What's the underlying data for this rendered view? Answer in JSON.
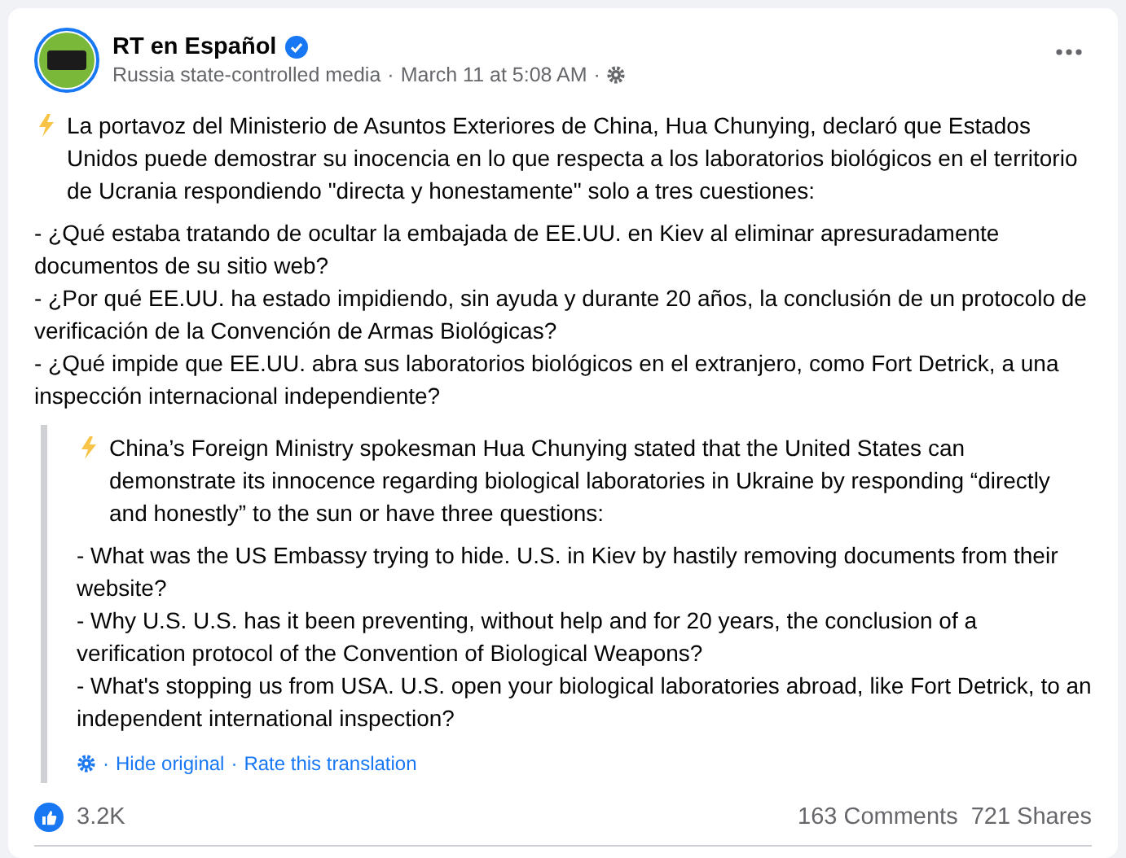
{
  "post": {
    "page_name": "RT en Español",
    "verified": true,
    "subtitle": "Russia state-controlled media",
    "separator": "·",
    "time": "March 11 at 5:08 AM",
    "body": {
      "intro": "La portavoz del Ministerio de Asuntos Exteriores de China, Hua Chunying, declaró que Estados Unidos puede demostrar su inocencia en lo que respecta a los laboratorios biológicos en el territorio de Ucrania respondiendo \"directa y honestamente\" solo a tres cuestiones:",
      "bullets": [
        "- ¿Qué estaba tratando de ocultar la embajada de EE.UU. en Kiev al eliminar apresuradamente documentos de su sitio web?",
        "- ¿Por qué EE.UU. ha estado impidiendo, sin ayuda y durante 20 años, la conclusión de un protocolo de verificación de la Convención de Armas Biológicas?",
        "- ¿Qué impide que EE.UU. abra sus laboratorios biológicos en el extranjero, como Fort Detrick, a una inspección internacional independiente?"
      ]
    },
    "translation": {
      "intro": "China’s Foreign Ministry spokesman Hua Chunying stated that the United States can demonstrate its innocence regarding biological laboratories in Ukraine by responding “directly and honestly” to the sun or have three questions:",
      "bullets": [
        "- What was the US Embassy trying to hide. U.S. in Kiev by hastily removing documents from their website?",
        "- Why U.S. U.S. has it been preventing, without help and for 20 years, the conclusion of a verification protocol of the Convention of Biological Weapons?",
        "- What's stopping us from USA. U.S. open your biological laboratories abroad, like Fort Detrick, to an independent international inspection?"
      ],
      "links": [
        "Hide original",
        "Rate this translation"
      ]
    },
    "reactions": "3.2K",
    "comments": "163 Comments",
    "shares": "721 Shares"
  }
}
